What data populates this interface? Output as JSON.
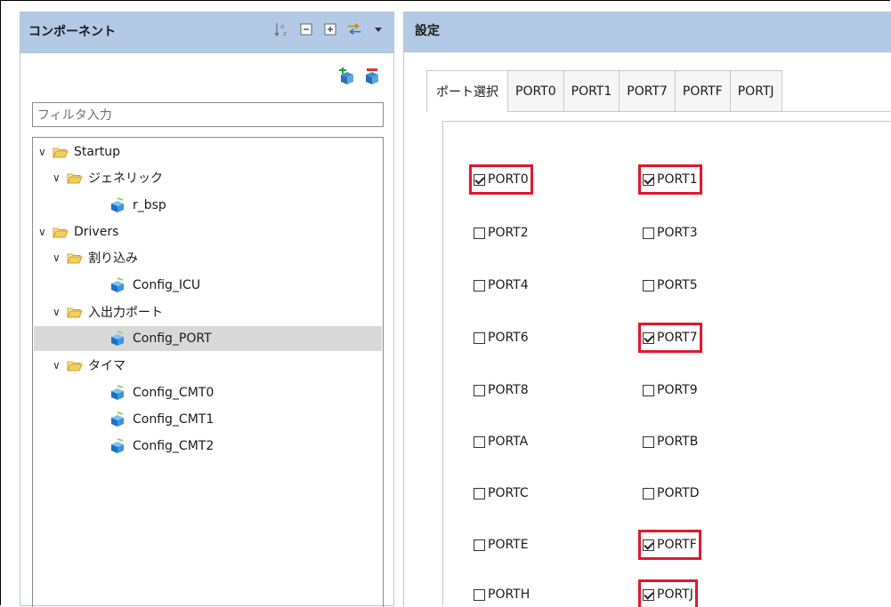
{
  "left_panel": {
    "title": "コンポーネント",
    "toolbar_icons": [
      "sort-az-icon",
      "collapse-all-icon",
      "expand-all-icon",
      "link-sync-icon",
      "dropdown-arrow-icon"
    ],
    "action_icons": [
      "add-component-icon",
      "remove-component-icon"
    ],
    "filter_placeholder": "フィルタ入力",
    "tree": [
      {
        "label": "Startup",
        "type": "folder",
        "level": 0,
        "expanded": true
      },
      {
        "label": "ジェネリック",
        "type": "folder",
        "level": 1,
        "expanded": true
      },
      {
        "label": "r_bsp",
        "type": "component",
        "level": 2
      },
      {
        "label": "Drivers",
        "type": "folder",
        "level": 0,
        "expanded": true
      },
      {
        "label": "割り込み",
        "type": "folder",
        "level": 1,
        "expanded": true
      },
      {
        "label": "Config_ICU",
        "type": "component",
        "level": 2
      },
      {
        "label": "入出力ポート",
        "type": "folder",
        "level": 1,
        "expanded": true
      },
      {
        "label": "Config_PORT",
        "type": "component",
        "level": 2,
        "selected": true
      },
      {
        "label": "タイマ",
        "type": "folder",
        "level": 1,
        "expanded": true
      },
      {
        "label": "Config_CMT0",
        "type": "component",
        "level": 2
      },
      {
        "label": "Config_CMT1",
        "type": "component",
        "level": 2
      },
      {
        "label": "Config_CMT2",
        "type": "component",
        "level": 2
      }
    ]
  },
  "right_panel": {
    "title": "設定",
    "tabs": [
      "ポート選択",
      "PORT0",
      "PORT1",
      "PORT7",
      "PORTF",
      "PORTJ"
    ],
    "active_tab": "ポート選択",
    "ports": [
      {
        "label": "PORT0",
        "checked": true,
        "highlighted": true
      },
      {
        "label": "PORT1",
        "checked": true,
        "highlighted": true
      },
      {
        "label": "PORT2",
        "checked": false
      },
      {
        "label": "PORT3",
        "checked": false
      },
      {
        "label": "PORT4",
        "checked": false
      },
      {
        "label": "PORT5",
        "checked": false
      },
      {
        "label": "PORT6",
        "checked": false
      },
      {
        "label": "PORT7",
        "checked": true,
        "highlighted": true
      },
      {
        "label": "PORT8",
        "checked": false
      },
      {
        "label": "PORT9",
        "checked": false
      },
      {
        "label": "PORTA",
        "checked": false
      },
      {
        "label": "PORTB",
        "checked": false
      },
      {
        "label": "PORTC",
        "checked": false
      },
      {
        "label": "PORTD",
        "checked": false
      },
      {
        "label": "PORTE",
        "checked": false
      },
      {
        "label": "PORTF",
        "checked": true,
        "highlighted": true
      },
      {
        "label": "PORTH",
        "checked": false
      },
      {
        "label": "PORTJ",
        "checked": true,
        "highlighted": true
      }
    ]
  },
  "colors": {
    "header_bg": "#b3c9e6",
    "highlight_red": "#e0182d",
    "selected_row": "#d9d9d9"
  }
}
